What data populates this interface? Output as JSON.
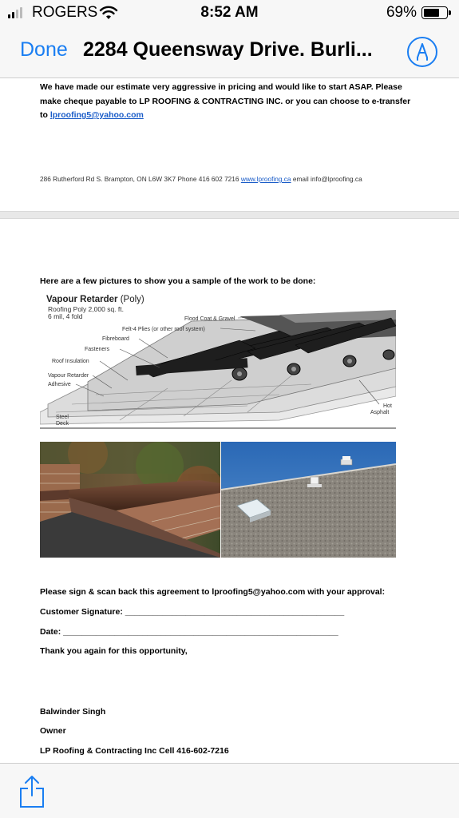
{
  "status_bar": {
    "carrier": "ROGERS",
    "time": "8:52 AM",
    "battery_percent": "69%",
    "battery_level": 0.69,
    "signal_bars": 2
  },
  "nav": {
    "done_label": "Done",
    "title": "2284 Queensway Drive. Burli...",
    "markup_icon": "markup-pen-icon"
  },
  "document": {
    "intro_line1": "We have made our estimate very aggressive in pricing and would like to start ASAP. Please",
    "intro_line2": "make cheque payable to LP ROOFING & CONTRACTING INC.  or you can choose to e-transfer",
    "intro_line3_prefix": "to ",
    "intro_email": "lproofing5@yahoo.com",
    "footer_address": "286 Rutherford Rd S. Brampton, ON L6W 3K7 Phone 416 602 7216 ",
    "footer_website": "www.lproofing.ca",
    "footer_email": " email info@lproofing.ca",
    "pictures_heading": "Here are a few pictures to show you a sample of the work to be done:",
    "diagram": {
      "title": "Vapour Retarder",
      "title_suffix": "(Poly)",
      "subtitle1": "Roofing Poly 2,000 sq. ft.",
      "subtitle2": "6 mil, 4 fold",
      "labels": {
        "flood_coat": "Flood Coat & Gravel",
        "felt": "Felt-4 Plies (or other roof system)",
        "fibreboard": "Fibreboard",
        "fasteners": "Fasteners",
        "roof_insulation": "Roof Insulation",
        "vapour_retarder": "Vapour Retarder",
        "adhesive": "Adhesive",
        "steel": "Steel",
        "deck": "Deck",
        "hot": "Hot",
        "asphalt": "Asphalt"
      }
    },
    "sign_line": "Please sign & scan back this agreement to lproofing5@yahoo.com with your approval:",
    "customer_signature": "Customer Signature: _______________________________________________",
    "date_line": "Date: ___________________________________________________________",
    "thanks": "Thank you again for this opportunity,",
    "name": "Balwinder Singh",
    "role": "Owner",
    "company": "LP Roofing & Contracting Inc Cell 416-602-7216"
  },
  "toolbar": {
    "share_icon": "share-icon"
  },
  "colors": {
    "accent": "#1a7ef2",
    "link": "#1a5cc8",
    "bar_bg": "#f7f7f7"
  }
}
